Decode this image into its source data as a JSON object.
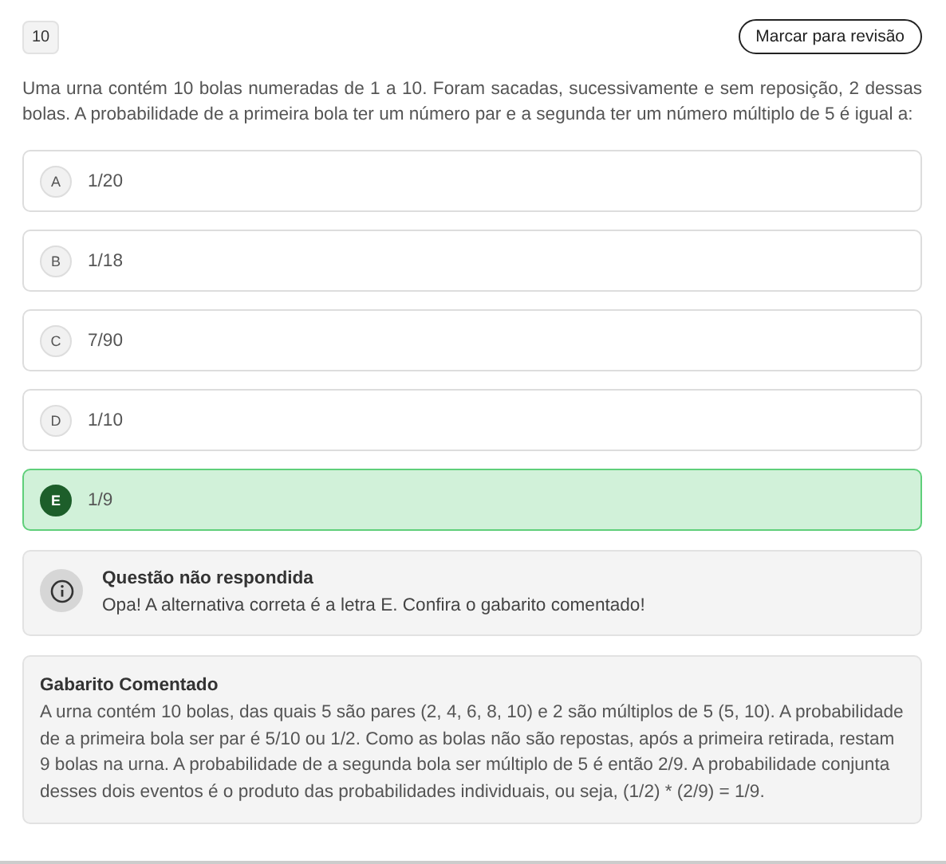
{
  "question_number": "10",
  "review_button": "Marcar para revisão",
  "question": "Uma urna contém 10 bolas numeradas de 1 a 10. Foram sacadas, sucessivamente e sem reposição, 2 dessas bolas. A probabilidade de a primeira bola ter um número par e a segunda ter um número múltiplo de 5 é igual a:",
  "options": [
    {
      "letter": "A",
      "text": "1/20",
      "correct": false
    },
    {
      "letter": "B",
      "text": "1/18",
      "correct": false
    },
    {
      "letter": "C",
      "text": "7/90",
      "correct": false
    },
    {
      "letter": "D",
      "text": "1/10",
      "correct": false
    },
    {
      "letter": "E",
      "text": "1/9",
      "correct": true
    }
  ],
  "notice": {
    "title": "Questão não respondida",
    "message": "Opa! A alternativa correta é a letra E. Confira o gabarito comentado!"
  },
  "explanation": {
    "title": "Gabarito Comentado",
    "text": "A urna contém 10 bolas, das quais 5 são pares (2, 4, 6, 8, 10) e 2 são múltiplos de 5 (5, 10). A probabilidade de a primeira bola ser par é 5/10 ou 1/2. Como as bolas não são repostas, após a primeira retirada, restam 9 bolas na urna. A probabilidade de a segunda bola ser múltiplo de 5 é então 2/9. A probabilidade conjunta desses dois eventos é o produto das probabilidades individuais, ou seja, (1/2) * (2/9) = 1/9."
  }
}
